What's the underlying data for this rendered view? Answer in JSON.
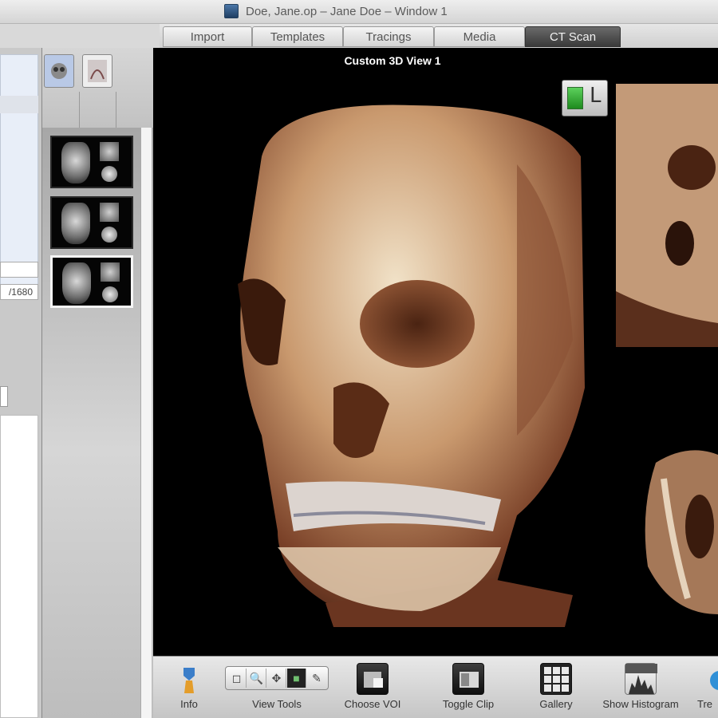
{
  "window": {
    "title": "Doe, Jane.op – Jane Doe – Window 1"
  },
  "tabs": [
    {
      "label": "Import",
      "active": false
    },
    {
      "label": "Templates",
      "active": false
    },
    {
      "label": "Tracings",
      "active": false
    },
    {
      "label": "Media",
      "active": false
    },
    {
      "label": "CT Scan",
      "active": true
    }
  ],
  "left_panel": {
    "field_text": "/1680"
  },
  "viewer": {
    "title": "Custom 3D View 1",
    "mini_ctrl_letter": "L"
  },
  "toolbar": {
    "items": [
      {
        "label": "Info",
        "icon": "info-icon"
      },
      {
        "label": "View Tools",
        "icon": "view-tools-icon"
      },
      {
        "label": "Choose VOI",
        "icon": "choose-voi-icon"
      },
      {
        "label": "Toggle Clip",
        "icon": "toggle-clip-icon"
      },
      {
        "label": "Gallery",
        "icon": "gallery-icon"
      },
      {
        "label": "Show Histogram",
        "icon": "histogram-icon"
      },
      {
        "label": "Tre",
        "icon": "tree-icon"
      }
    ],
    "view_tools_glyphs": [
      "◻",
      "🔍",
      "✥",
      "■",
      "✎"
    ]
  },
  "colors": {
    "viewer_bg": "#000000",
    "active_tab": "#3a3a3a",
    "bone_light": "#e8d6b8",
    "bone_dark": "#7a4128"
  }
}
